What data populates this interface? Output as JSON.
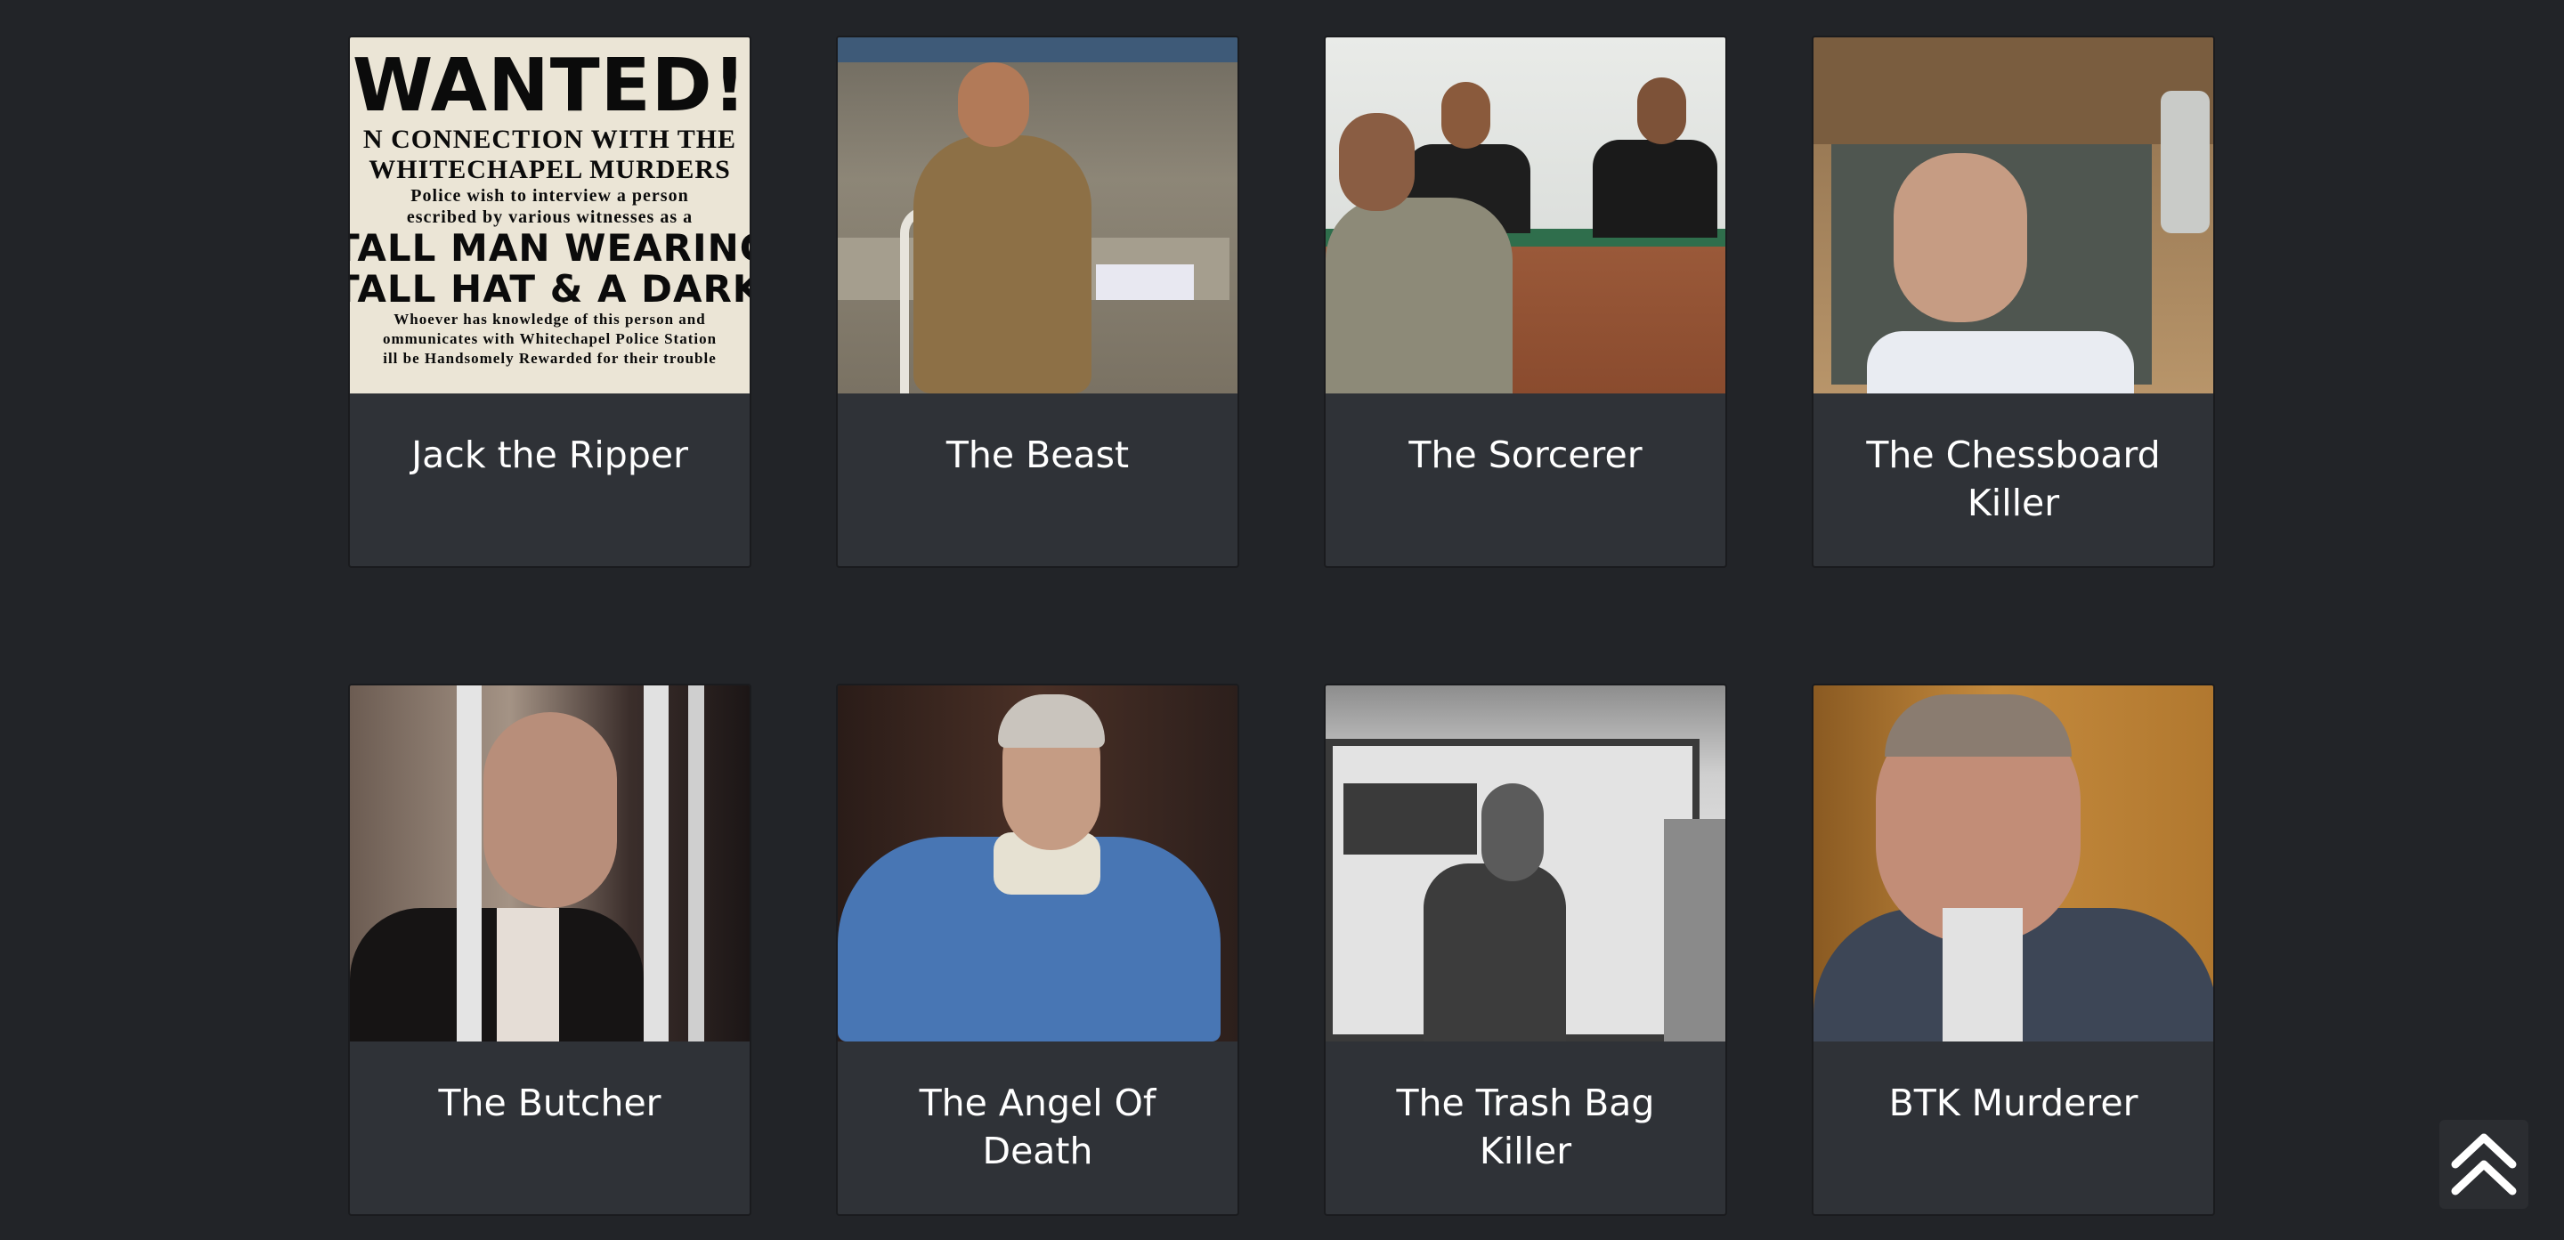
{
  "cards": [
    {
      "title": "Jack the Ripper",
      "image": "wanted-poster",
      "poster_lines": [
        "WANTED!",
        "N CONNECTION WITH THE",
        "WHITECHAPEL MURDERS",
        "Police wish to interview a person",
        "escribed by various witnesses as a",
        "TALL MAN WEARING A",
        "TALL HAT & A DARK CLOAK",
        "Whoever has knowledge of this person and",
        "ommunicates with Whitechapel Police Station",
        "ill be Handsomely Rewarded for their trouble"
      ]
    },
    {
      "title": "The Beast",
      "image": "man-seated-in-cell-photo"
    },
    {
      "title": "The Sorcerer",
      "image": "courtroom-photo"
    },
    {
      "title": "The Chessboard Killer",
      "image": "man-behind-glass-photo"
    },
    {
      "title": "The Butcher",
      "image": "man-behind-bars-photo"
    },
    {
      "title": "The Angel Of Death",
      "image": "man-in-denim-jacket-photo"
    },
    {
      "title": "The Trash Bag Killer",
      "image": "man-by-van-photo"
    },
    {
      "title": "BTK Murderer",
      "image": "man-with-glasses-photo"
    }
  ],
  "scroll_top": {
    "icon": "double-chevron-up-icon"
  },
  "colors": {
    "background": "#222428",
    "card": "#2f3237",
    "text": "#ffffff"
  }
}
